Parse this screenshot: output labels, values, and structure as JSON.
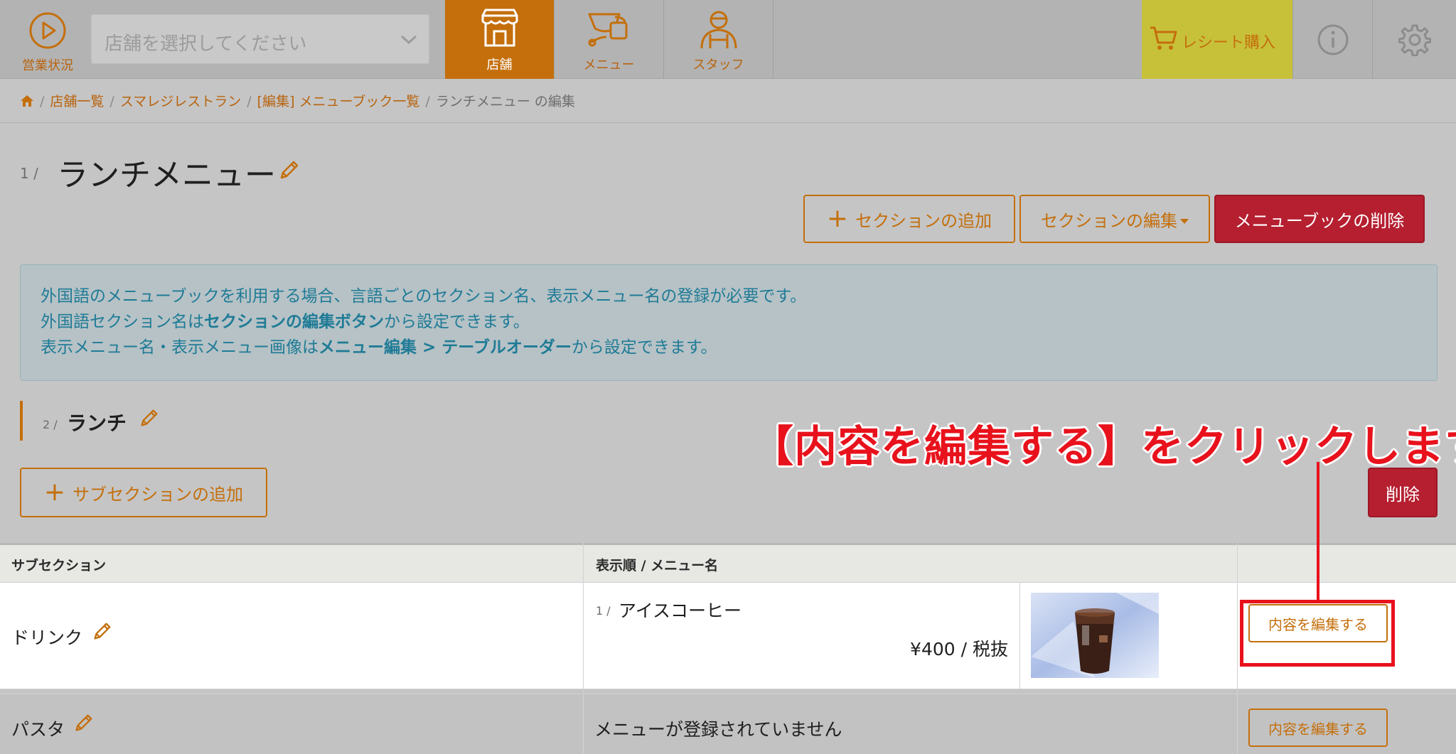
{
  "topbar": {
    "status_label": "営業状況",
    "store_select_placeholder": "店舗を選択してください",
    "tabs": [
      {
        "label": "店舗",
        "icon": "store-icon",
        "active": true
      },
      {
        "label": "メニュー",
        "icon": "menu-cup-icon",
        "active": false
      },
      {
        "label": "スタッフ",
        "icon": "staff-icon",
        "active": false
      }
    ],
    "receipt_label": "レシート購入",
    "accent_color": "#c46f0c",
    "receipt_color": "#c7c13a"
  },
  "breadcrumb": {
    "items": [
      "店舗一覧",
      "スマレジレストラン",
      "[編集] メニューブック一覧"
    ],
    "current": "ランチメニュー の編集",
    "separator": "/"
  },
  "page": {
    "number": "1 /",
    "title": "ランチメニュー"
  },
  "actions": {
    "add_section": "セクションの追加",
    "edit_section": "セクションの編集",
    "delete_menubook": "メニューブックの削除",
    "danger_color": "#b51f30"
  },
  "info": {
    "line1": "外国語のメニューブックを利用する場合、言語ごとのセクション名、表示メニュー名の登録が必要です。",
    "line2_pre": "外国語セクション名は",
    "line2_bold": "セクションの編集ボタン",
    "line2_post": "から設定できます。",
    "line3_pre": "表示メニュー名・表示メニュー画像は",
    "line3_bold": "メニュー編集 > テーブルオーダー",
    "line3_post": "から設定できます。"
  },
  "section": {
    "number": "2 /",
    "name": "ランチ",
    "add_subsection": "サブセクションの追加",
    "delete": "削除"
  },
  "annotation": {
    "text": "【内容を編集する】をクリックします。",
    "color": "#e8121c"
  },
  "table": {
    "headers": [
      "サブセクション",
      "表示順 / メニュー名"
    ],
    "rows": [
      {
        "subsection": "ドリンク",
        "item_number": "1 /",
        "item_name": "アイスコーヒー",
        "price": "¥400 / 税抜",
        "edit_label": "内容を編集する"
      },
      {
        "subsection": "パスタ",
        "empty_message": "メニューが登録されていません",
        "edit_label": "内容を編集する"
      }
    ]
  }
}
